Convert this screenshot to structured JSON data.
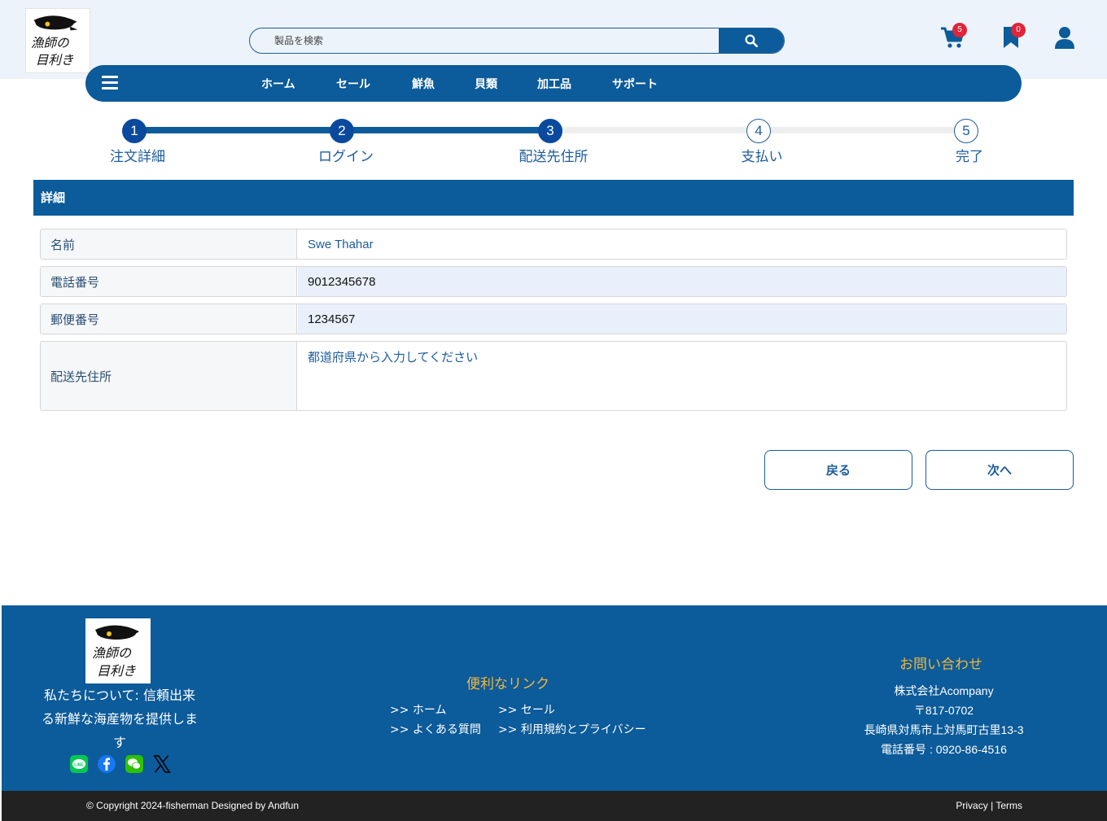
{
  "header": {
    "logo_text": "漁師の目利き",
    "search_placeholder": "製品を検索",
    "cart_count": "5",
    "bookmark_count": "0"
  },
  "nav": {
    "items": [
      "ホーム",
      "セール",
      "鮮魚",
      "貝類",
      "加工品",
      "サポート"
    ]
  },
  "steps": [
    {
      "num": "1",
      "label": "注文詳細"
    },
    {
      "num": "2",
      "label": "ログイン"
    },
    {
      "num": "3",
      "label": "配送先住所"
    },
    {
      "num": "4",
      "label": "支払い"
    },
    {
      "num": "5",
      "label": "完了"
    }
  ],
  "current_step": 3,
  "section": {
    "title": "詳細",
    "fields": [
      {
        "label": "名前",
        "value": "Swe Thahar"
      },
      {
        "label": "電話番号",
        "value": "9012345678"
      },
      {
        "label": "郵便番号",
        "value": "1234567"
      },
      {
        "label": "配送先住所",
        "placeholder": "都道府県から入力してください"
      }
    ]
  },
  "buttons": {
    "back": "戻る",
    "next": "次へ"
  },
  "footer": {
    "logo_text": "漁師の目利き",
    "about": "私たちについて: 信頼出来る新鮮な海産物を提供します",
    "links_title": "便利なリンク",
    "links": [
      ">> ホーム",
      ">> セール",
      ">> よくある質問",
      ">> 利用規約とプライバシー"
    ],
    "contact_title": "お問い合わせ",
    "contact": [
      "株式会社Acompany",
      "〒817-0702",
      "長崎県対馬市上対馬町古里13-3",
      "電話番号 : 0920-86-4516"
    ],
    "copyright": "© Copyright 2024-fisherman Designed by Andfun",
    "privacy": "Privacy",
    "separator": "|",
    "terms": "Terms"
  },
  "colors": {
    "primary": "#0c5b9a",
    "step_active": "#0a4a9e",
    "accent": "#f0b63c",
    "badge": "#e0243b"
  },
  "icons": [
    "search-icon",
    "cart-icon",
    "bookmark-icon",
    "user-icon",
    "hamburger-icon",
    "line-icon",
    "facebook-icon",
    "wechat-icon",
    "x-icon"
  ]
}
